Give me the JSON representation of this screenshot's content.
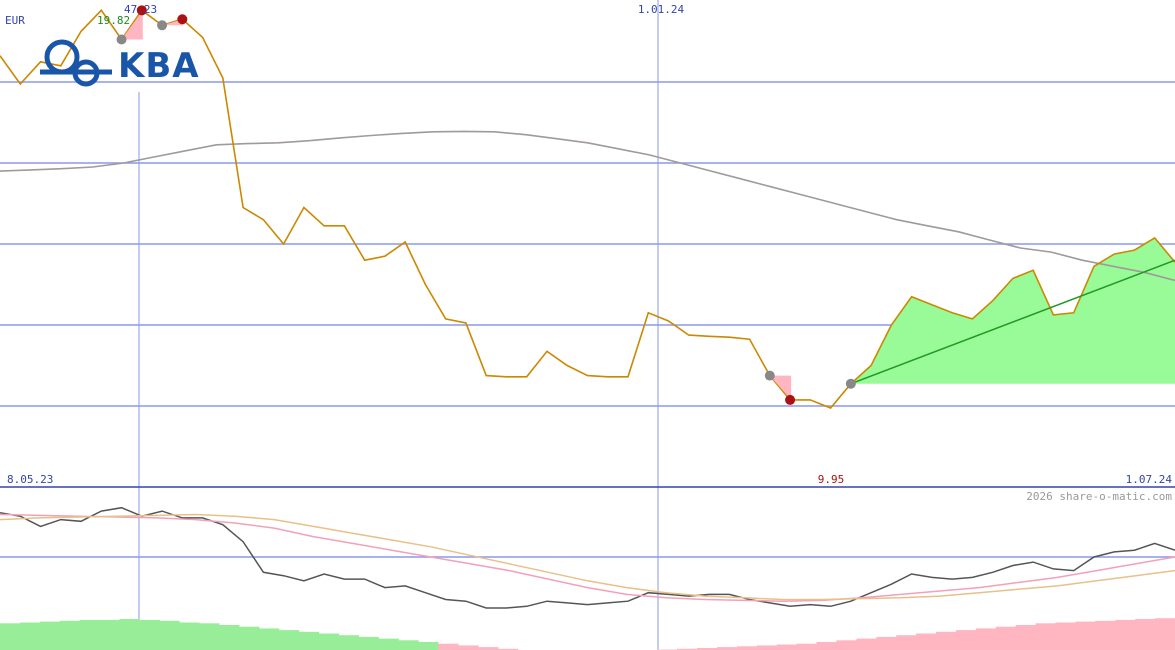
{
  "chart_data": [
    {
      "type": "line",
      "currency_label": "EUR",
      "y_ticks": [
        10,
        12,
        14,
        16,
        18
      ],
      "ylim": [
        8.0,
        19.9
      ],
      "x_labels": {
        "start": "8.05.23",
        "mid": "1.01.24",
        "end": "1.07.24"
      },
      "callouts": {
        "high_date": "47.23",
        "high_value": "19.82",
        "low_value": "9.95"
      },
      "copyright": "2026 share-o-matic.com",
      "logo": {
        "text": "KBA",
        "icon": "kba-rings-icon"
      },
      "colors": {
        "price": "#cc8800",
        "average": "#a09a9a",
        "trend": "#229922",
        "fill": "#98fb98",
        "marker_red": "#aa1111",
        "marker_grey": "#888888",
        "flag": "#ffb6c1",
        "grid": "#8899ee"
      },
      "series": [
        {
          "kind": "price",
          "values": [
            18.65,
            17.95,
            18.5,
            18.4,
            19.25,
            19.77,
            19.05,
            19.77,
            19.4,
            19.55,
            19.1,
            18.1,
            14.9,
            14.6,
            14.0,
            14.9,
            14.45,
            14.45,
            13.6,
            13.7,
            14.05,
            13.0,
            12.15,
            12.05,
            10.75,
            10.72,
            10.72,
            11.35,
            11.0,
            10.75,
            10.72,
            10.72,
            12.3,
            12.1,
            11.75,
            11.72,
            11.7,
            11.65,
            10.75,
            10.15,
            10.15,
            9.95,
            10.55,
            11.0,
            12.0,
            12.7,
            12.5,
            12.3,
            12.15,
            12.6,
            13.15,
            13.35,
            12.25,
            12.3,
            13.45,
            13.75,
            13.85,
            14.15,
            13.55
          ]
        },
        {
          "kind": "average",
          "values": [
            15.8,
            15.83,
            15.86,
            15.9,
            16.0,
            16.15,
            16.3,
            16.45,
            16.48,
            16.5,
            16.55,
            16.62,
            16.68,
            16.73,
            16.77,
            16.78,
            16.77,
            16.7,
            16.6,
            16.5,
            16.35,
            16.2,
            16.0,
            15.8,
            15.6,
            15.4,
            15.2,
            15.0,
            14.8,
            14.6,
            14.45,
            14.3,
            14.1,
            13.9,
            13.8,
            13.6,
            13.45,
            13.3,
            13.1
          ]
        }
      ],
      "trend_line": {
        "from": 10.55,
        "to": 13.6
      },
      "highlight_level": 10.55
    },
    {
      "type": "line",
      "y_ticks": [
        30,
        0,
        -40
      ],
      "ylim": [
        -42,
        32
      ],
      "series": [
        {
          "kind": "oscillator",
          "values": [
            26,
            24,
            18,
            22,
            21,
            27,
            29,
            24,
            27,
            23,
            23,
            19,
            9,
            -9,
            -11,
            -14,
            -10,
            -13,
            -13,
            -18,
            -17,
            -21,
            -25,
            -26,
            -30,
            -30,
            -29,
            -26,
            -27,
            -28,
            -27,
            -26,
            -21,
            -22,
            -23,
            -22,
            -22,
            -25,
            -27,
            -29,
            -28,
            -29,
            -26,
            -21,
            -16,
            -10,
            -12,
            -13,
            -12,
            -9,
            -5,
            -3,
            -7,
            -8,
            0,
            3,
            4,
            8,
            4
          ]
        },
        {
          "kind": "signal_fast",
          "values": [
            25,
            24.5,
            24,
            23.5,
            23,
            22,
            20,
            17,
            12,
            8,
            4,
            0,
            -4,
            -8,
            -13,
            -18,
            -22,
            -24,
            -25,
            -25.5,
            -26,
            -25.5,
            -24,
            -22,
            -20,
            -18,
            -15,
            -12,
            -8,
            -4,
            0
          ]
        },
        {
          "kind": "signal_slow",
          "values": [
            22,
            23,
            23.5,
            24,
            24.5,
            25,
            24,
            22,
            18,
            14,
            10,
            6,
            1,
            -4,
            -9,
            -14,
            -18,
            -21,
            -23,
            -24,
            -25,
            -25,
            -24.5,
            -24,
            -23,
            -21,
            -19,
            -17,
            -14,
            -11,
            -8
          ]
        },
        {
          "kind": "histogram",
          "values": [
            -39,
            -38.5,
            -38,
            -37.5,
            -37,
            -37,
            -36.5,
            -37,
            -37.5,
            -38.5,
            -39,
            -40,
            -41,
            -42,
            -43,
            -44,
            -45,
            -46,
            -47,
            -48,
            -49,
            -50,
            -51,
            -52,
            -53,
            -54,
            -55,
            -56,
            -57,
            -56.5,
            -56,
            -55.5,
            -55,
            -54.5,
            -54,
            -53.5,
            -53,
            -52.5,
            -52,
            -51.5,
            -51,
            -50,
            -49,
            -48,
            -47,
            -46,
            -45,
            -44,
            -43,
            -42,
            -41,
            -40,
            -39,
            -38.5,
            -38,
            -37.5,
            -37,
            -36.5,
            -36
          ]
        }
      ]
    }
  ]
}
